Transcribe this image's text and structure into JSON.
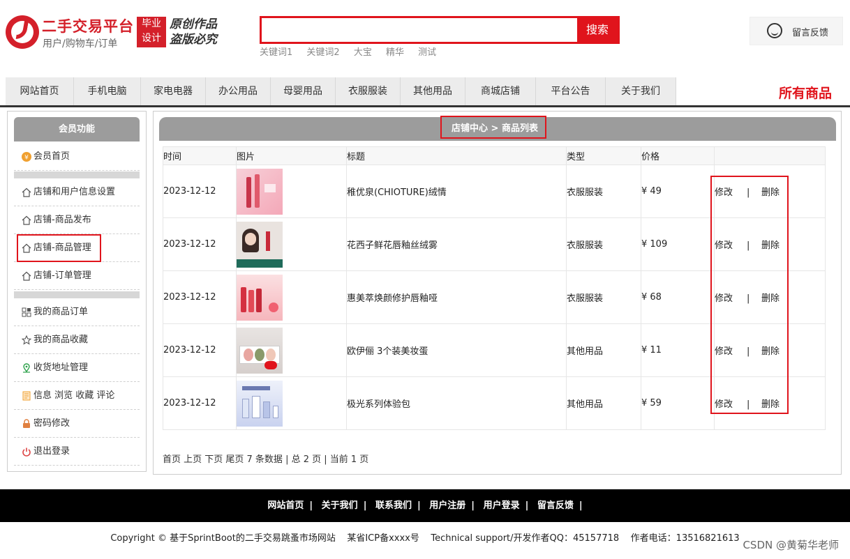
{
  "brand": {
    "title": "二手交易平台",
    "subtitle": "用户/购物车/订单",
    "badge_top": "毕业",
    "badge_bottom": "设计",
    "slogan": "原创作品 盗版必究"
  },
  "search": {
    "placeholder": "",
    "button_label": "搜索",
    "keywords": [
      "关键词1",
      "关键词2",
      "大宝",
      "精华",
      "测试"
    ]
  },
  "feedback": {
    "label": "留言反馈",
    "icon": "customer-service-icon"
  },
  "nav": {
    "items": [
      "网站首页",
      "手机电脑",
      "家电电器",
      "办公用品",
      "母婴用品",
      "衣服服装",
      "其他用品",
      "商城店铺",
      "平台公告",
      "关于我们"
    ],
    "all_goods": "所有商品"
  },
  "sidebar": {
    "title": "会员功能",
    "items": [
      {
        "label": "会员首页",
        "icon": "member-coin-icon"
      },
      {
        "label": "店铺和用户信息设置",
        "icon": "home-icon"
      },
      {
        "label": "店铺-商品发布",
        "icon": "home-icon"
      },
      {
        "label": "店铺-商品管理",
        "icon": "home-icon"
      },
      {
        "label": "店铺-订单管理",
        "icon": "home-icon"
      },
      {
        "label": "我的商品订单",
        "icon": "grid-icon"
      },
      {
        "label": "我的商品收藏",
        "icon": "star-icon"
      },
      {
        "label": "收货地址管理",
        "icon": "location-icon"
      },
      {
        "label": "信息 浏览 收藏 评论",
        "icon": "document-icon"
      },
      {
        "label": "密码修改",
        "icon": "lock-icon"
      },
      {
        "label": "退出登录",
        "icon": "power-icon"
      }
    ]
  },
  "main": {
    "breadcrumb": "店铺中心 > 商品列表",
    "columns": [
      "时间",
      "图片",
      "标题",
      "类型",
      "价格",
      ""
    ],
    "rows": [
      {
        "time": "2023-12-12",
        "title": "稚优泉(CHIOTURE)绒情",
        "type": "衣服服装",
        "price": "¥ 49",
        "edit": "修改",
        "sep": "|",
        "delete": "删除"
      },
      {
        "time": "2023-12-12",
        "title": "花西子鲜花唇釉丝绒雾",
        "type": "衣服服装",
        "price": "¥ 109",
        "edit": "修改",
        "sep": "|",
        "delete": "删除"
      },
      {
        "time": "2023-12-12",
        "title": "惠美萃焕颜修护唇釉哑",
        "type": "衣服服装",
        "price": "¥ 68",
        "edit": "修改",
        "sep": "|",
        "delete": "删除"
      },
      {
        "time": "2023-12-12",
        "title": "欧伊俪 3个装美妆蛋",
        "type": "其他用品",
        "price": "¥ 11",
        "edit": "修改",
        "sep": "|",
        "delete": "删除"
      },
      {
        "time": "2023-12-12",
        "title": "极光系列体验包",
        "type": "其他用品",
        "price": "¥ 59",
        "edit": "修改",
        "sep": "|",
        "delete": "删除"
      }
    ],
    "pager": "首页 上页 下页 尾页 7 条数据 | 总 2 页 | 当前 1 页"
  },
  "footer": {
    "links": [
      "网站首页",
      "关于我们",
      "联系我们",
      "用户注册",
      "用户登录",
      "留言反馈"
    ],
    "separator": "|",
    "copyright": "Copyright © 基于SprintBoot的二手交易跳蚤市场网站    某省ICP备xxxx号    Technical support/开发作者QQ：45157718    作者电话：13516821613",
    "watermark": "CSDN @黄菊华老师"
  },
  "colors": {
    "accent": "#e0141c",
    "header_gray": "#9c9c9c",
    "footer_bg": "#000000"
  }
}
